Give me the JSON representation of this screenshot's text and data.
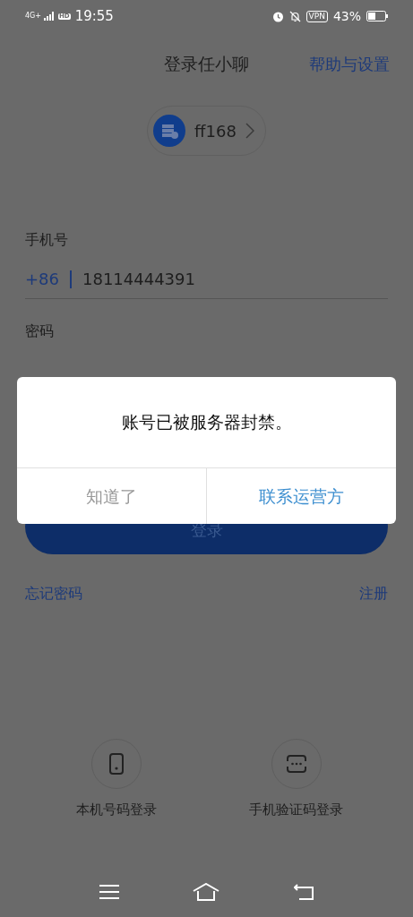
{
  "status_bar": {
    "network": "4G+",
    "hd": "HD",
    "time": "19:55",
    "vpn": "VPN",
    "battery": "43%"
  },
  "header": {
    "title": "登录任小聊",
    "action": "帮助与设置"
  },
  "server": {
    "name": "ff168"
  },
  "fields": [
    {
      "label": "手机号",
      "prefix": "+86",
      "value": "18114444391"
    },
    {
      "label": "密码"
    }
  ],
  "login_button": "登录",
  "links": [
    "忘记密码",
    "注册"
  ],
  "alt_logins": [
    {
      "kind": "phone",
      "label": "本机号码登录"
    },
    {
      "kind": "code",
      "label": "手机验证码登录"
    }
  ],
  "dialog": {
    "message": "账号已被服务器封禁。",
    "buttons": [
      {
        "label": "知道了",
        "primary": false
      },
      {
        "label": "联系运营方",
        "primary": true
      }
    ]
  }
}
